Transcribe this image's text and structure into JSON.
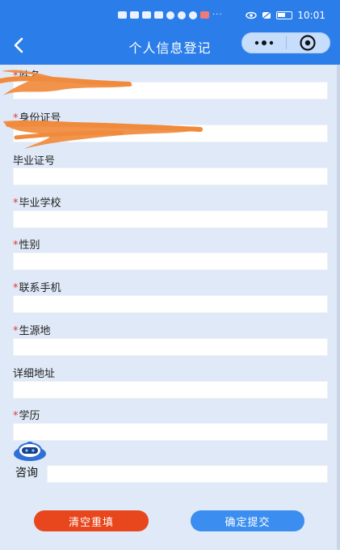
{
  "status_bar": {
    "time": "10:01",
    "dots": "···"
  },
  "nav": {
    "title": "个人信息登记"
  },
  "form": {
    "fields": [
      {
        "label": "姓名",
        "required": true,
        "value": ""
      },
      {
        "label": "身份证号",
        "required": true,
        "value": ""
      },
      {
        "label": "毕业证号",
        "required": false,
        "value": ""
      },
      {
        "label": "毕业学校",
        "required": true,
        "value": ""
      },
      {
        "label": "性别",
        "required": true,
        "value": ""
      },
      {
        "label": "联系手机",
        "required": true,
        "value": ""
      },
      {
        "label": "生源地",
        "required": true,
        "value": ""
      },
      {
        "label": "详细地址",
        "required": false,
        "value": ""
      },
      {
        "label": "学历",
        "required": true,
        "value": ""
      }
    ],
    "required_mark": "*"
  },
  "consult": {
    "label": "咨询",
    "value": ""
  },
  "buttons": {
    "reset": "清空重填",
    "submit": "确定提交"
  },
  "colors": {
    "nav_bg": "#2b7ee9",
    "page_bg": "#dfe9f7",
    "required": "#e53935",
    "reset_btn": "#e8461d",
    "submit_btn": "#3b8ef0",
    "redaction": "#f08a3c"
  }
}
